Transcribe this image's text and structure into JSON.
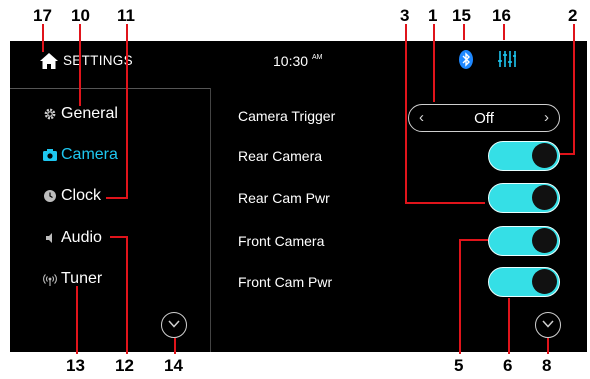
{
  "header": {
    "title": "SETTINGS",
    "time": "10:30",
    "ampm": "AM"
  },
  "sidebar": {
    "items": [
      {
        "label": "General",
        "icon": "gear-icon",
        "active": false
      },
      {
        "label": "Camera",
        "icon": "camera-icon",
        "active": true
      },
      {
        "label": "Clock",
        "icon": "clock-icon",
        "active": false
      },
      {
        "label": "Audio",
        "icon": "speaker-icon",
        "active": false
      },
      {
        "label": "Tuner",
        "icon": "antenna-icon",
        "active": false
      }
    ]
  },
  "settings": {
    "camera_trigger": {
      "label": "Camera Trigger",
      "value": "Off",
      "prev": "‹",
      "next": "›"
    },
    "toggles": [
      {
        "label": "Rear Camera",
        "on": true
      },
      {
        "label": "Rear Cam Pwr",
        "on": true
      },
      {
        "label": "Front Camera",
        "on": true
      },
      {
        "label": "Front Cam Pwr",
        "on": true
      }
    ]
  },
  "annotations": [
    "17",
    "10",
    "11",
    "3",
    "1",
    "15",
    "16",
    "2",
    "13",
    "12",
    "14",
    "5",
    "6",
    "8"
  ],
  "colors": {
    "accent": "#1ec7f0",
    "toggle_on": "#35dfe6",
    "bluetooth": "#1e88ff",
    "eq": "#1ec7f0",
    "annotation_line": "#e0141b"
  }
}
